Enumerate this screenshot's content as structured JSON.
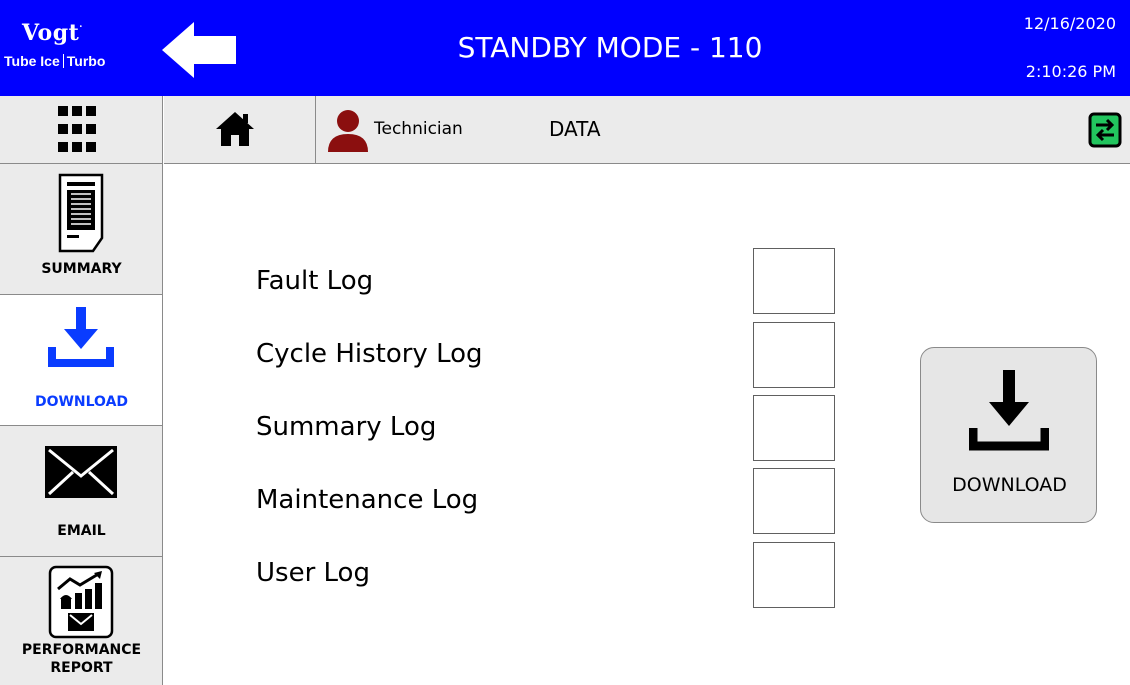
{
  "header": {
    "brand": "Vogt",
    "brand_sub_left": "Tube Ice",
    "brand_sub_right": "Turbo",
    "mode_title": "STANDBY MODE - 110",
    "date": "12/16/2020",
    "time": "2:10:26 PM",
    "color": "#0000ff"
  },
  "navbar": {
    "user_role": "Technician",
    "page_name": "DATA",
    "sync_color": "#22c55e"
  },
  "sidebar": {
    "items": [
      {
        "label": "SUMMARY",
        "icon": "document-icon"
      },
      {
        "label": "DOWNLOAD",
        "icon": "download-icon",
        "active": true
      },
      {
        "label": "EMAIL",
        "icon": "envelope-icon"
      },
      {
        "label": "PERFORMANCE REPORT",
        "label_line1": "PERFORMANCE",
        "label_line2": "REPORT",
        "icon": "report-icon"
      }
    ],
    "active_color": "#0a3cff"
  },
  "main": {
    "logs": [
      {
        "label": "Fault Log",
        "checked": false
      },
      {
        "label": "Cycle History Log",
        "checked": false
      },
      {
        "label": "Summary Log",
        "checked": false
      },
      {
        "label": "Maintenance Log",
        "checked": false
      },
      {
        "label": "User Log",
        "checked": false
      }
    ],
    "download_label": "DOWNLOAD"
  }
}
